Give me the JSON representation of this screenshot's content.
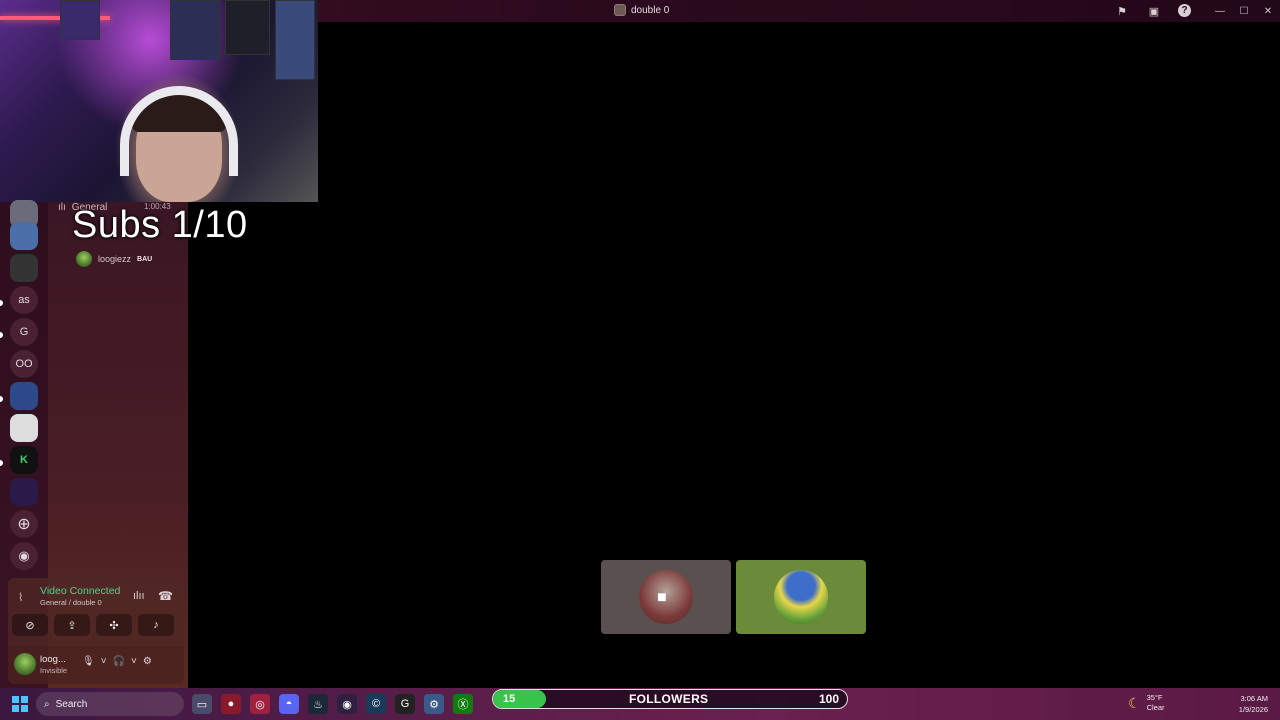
{
  "window": {
    "title": "double 0",
    "controls": [
      "minimize-icon",
      "maximize-icon",
      "close-icon"
    ],
    "toolbar_icons": [
      "flag-icon",
      "inbox-icon",
      "help-icon"
    ]
  },
  "overlay": {
    "subs_text": "Subs 1/10"
  },
  "server_rail": {
    "items": [
      {
        "type": "image",
        "name": "server-1"
      },
      {
        "type": "image",
        "name": "server-2"
      },
      {
        "type": "image",
        "name": "server-3"
      },
      {
        "type": "text",
        "label": "as"
      },
      {
        "type": "text",
        "label": "G"
      },
      {
        "type": "text",
        "label": "OO"
      },
      {
        "type": "image",
        "name": "server-7"
      },
      {
        "type": "image",
        "name": "server-8"
      },
      {
        "type": "image",
        "name": "server-9"
      },
      {
        "type": "image",
        "name": "server-10"
      },
      {
        "type": "icon",
        "name": "add-server-icon"
      },
      {
        "type": "icon",
        "name": "discover-icon"
      }
    ]
  },
  "channel_panel": {
    "voice_channel": "General",
    "voice_timer": "1:00:43",
    "user": {
      "name": "loogiezz",
      "tag": "BAU"
    }
  },
  "voice_status": {
    "title": "Video Connected",
    "subtitle": "General / double 0"
  },
  "user_panel": {
    "name": "loog...",
    "status": "Invisible"
  },
  "taskbar": {
    "search_placeholder": "Search",
    "followers_goal": {
      "current": "15",
      "label": "FOLLOWERS",
      "goal": "100",
      "progress": 0.15,
      "fill_color": "#38c34a"
    },
    "weather": {
      "temp": "35°F",
      "condition": "Clear"
    },
    "clock": {
      "time": "3:06 AM",
      "date": "1/9/2026"
    }
  }
}
